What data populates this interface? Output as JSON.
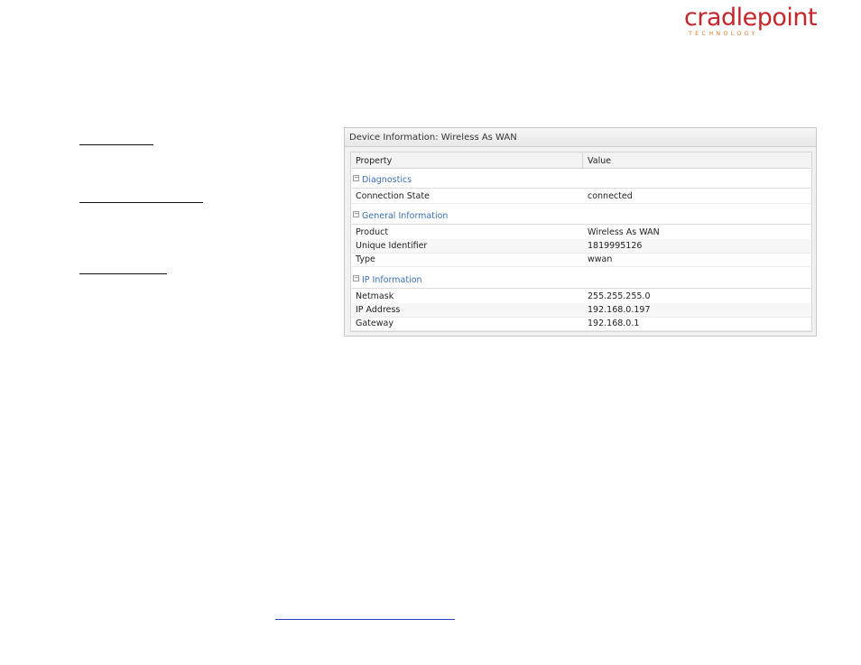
{
  "brand": {
    "logo_text": "cradlepoint",
    "logo_subtext": "TECHNOLOGY",
    "color": "#c3272b"
  },
  "panel": {
    "title": "Device Information: Wireless As WAN",
    "columns": [
      "Property",
      "Value"
    ],
    "groups": [
      {
        "label": "Diagnostics",
        "rows": [
          {
            "property": "Connection State",
            "value": "connected"
          }
        ]
      },
      {
        "label": "General Information",
        "rows": [
          {
            "property": "Product",
            "value": "Wireless As WAN"
          },
          {
            "property": "Unique Identifier",
            "value": "1819995126"
          },
          {
            "property": "Type",
            "value": "wwan"
          }
        ]
      },
      {
        "label": "IP Information",
        "rows": [
          {
            "property": "Netmask",
            "value": "255.255.255.0"
          },
          {
            "property": "IP Address",
            "value": "192.168.0.197"
          },
          {
            "property": "Gateway",
            "value": "192.168.0.1"
          }
        ]
      }
    ],
    "toggle_glyph": "−"
  }
}
